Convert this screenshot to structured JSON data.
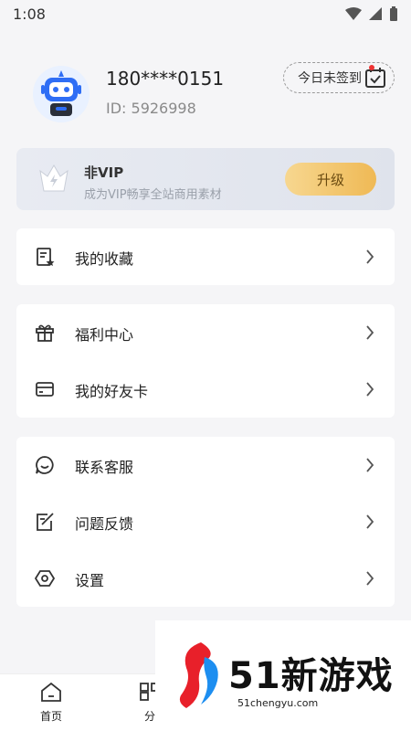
{
  "status_bar": {
    "time": "1:08"
  },
  "profile": {
    "username": "180****0151",
    "user_id": "ID: 5926998",
    "checkin_label": "今日未签到"
  },
  "vip": {
    "title": "非VIP",
    "subtitle": "成为VIP畅享全站商用素材",
    "upgrade_label": "升级"
  },
  "menu": {
    "favorites": "我的收藏",
    "welfare": "福利中心",
    "friend_card": "我的好友卡",
    "customer_service": "联系客服",
    "feedback": "问题反馈",
    "settings": "设置"
  },
  "bottom_nav": {
    "home": "首页",
    "category_partial": "分"
  },
  "watermark": {
    "brand": "51新游戏",
    "url": "51chengyu.com"
  },
  "colors": {
    "background": "#f5f5f7",
    "upgrade_gradient_start": "#f7d790",
    "upgrade_gradient_end": "#efb955",
    "checkin_dot": "#ee3333",
    "avatar_blue": "#2f6ef5"
  }
}
